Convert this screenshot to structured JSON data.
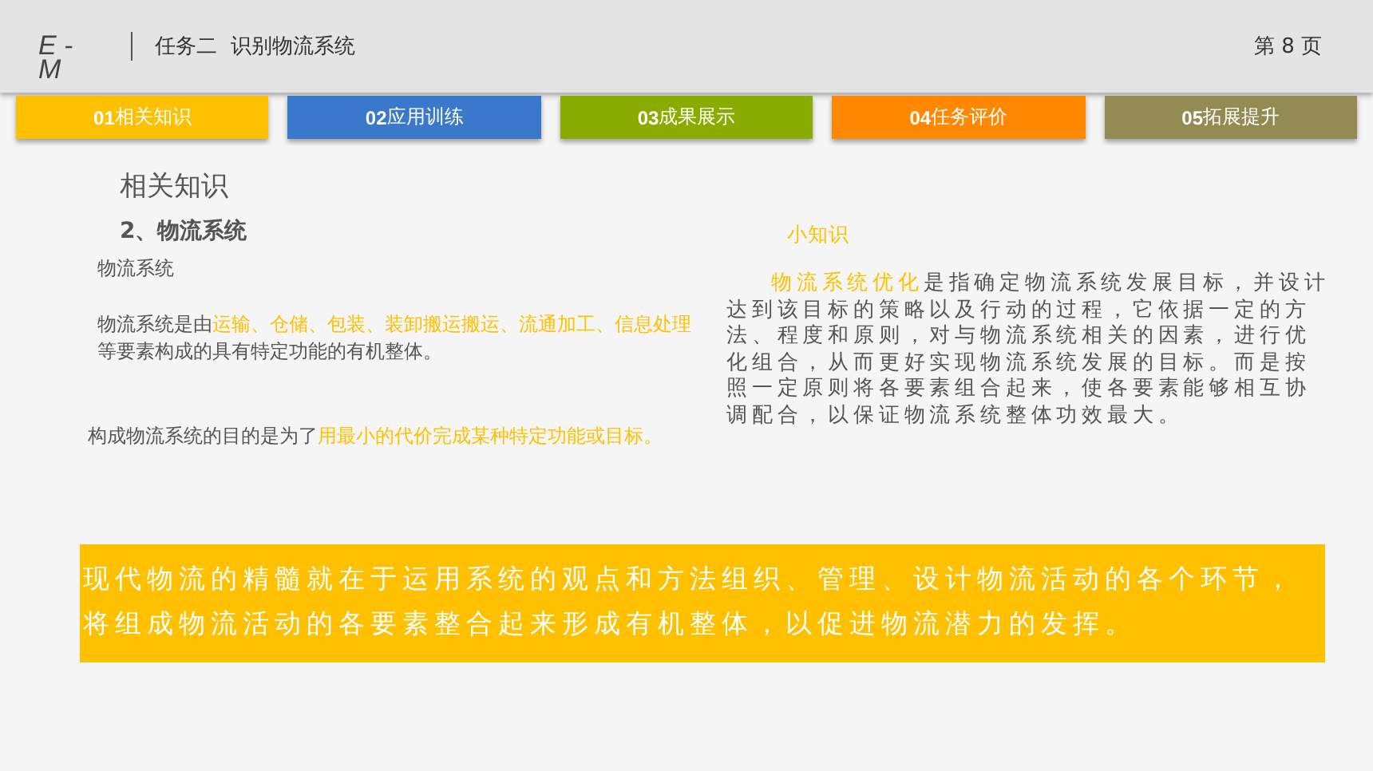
{
  "header": {
    "logo": [
      "E -",
      "M"
    ],
    "title": "任务二  识别物流系统",
    "page": "第 8 页"
  },
  "tabs": [
    {
      "number": "01",
      "label": "相关知识",
      "color": "#ffc000"
    },
    {
      "number": "02",
      "label": "应用训练",
      "color": "#3a78cc"
    },
    {
      "number": "03",
      "label": "成果展示",
      "color": "#8aac00"
    },
    {
      "number": "04",
      "label": "任务评价",
      "color": "#ff8800"
    },
    {
      "number": "05",
      "label": "拓展提升",
      "color": "#948a54"
    }
  ],
  "section_title": "相关知识",
  "subtitle": "2、物流系统",
  "label": "物流系统",
  "definition": [
    {
      "text": "物流系统是由",
      "highlight": false
    },
    {
      "text": "运输、仓储、包装、装卸搬运搬运、流通加工、信息处理",
      "highlight": true
    },
    {
      "text": "等要素构成的具有特定功能的有机整体。",
      "highlight": false
    }
  ],
  "purpose": [
    {
      "text": "构成物流系统的目的是为了",
      "highlight": false
    },
    {
      "text": "用最小的代价完成某种特定功能或目标。",
      "highlight": true
    }
  ],
  "tip": {
    "title": "小知识",
    "body": [
      {
        "text": "物流系统优化",
        "highlight": true
      },
      {
        "text": "是指确定物流系统发展目标，并设计达到该目标的策略以及行动的过程，它依据一定的方法、程度和原则，对与物流系统相关的因素，进行优化组合，从而更好实现物流系统发展的目标。而是按照一定原则将各要素组合起来，使各要素能够相互协调配合，以保证物流系统整体功效最大。",
        "highlight": false
      }
    ]
  },
  "banner": "现代物流的精髓就在于运用系统的观点和方法组织、管理、设计物流活动的各个环节，将组成物流活动的各要素整合起来形成有机整体，以促进物流潜力的发挥。"
}
